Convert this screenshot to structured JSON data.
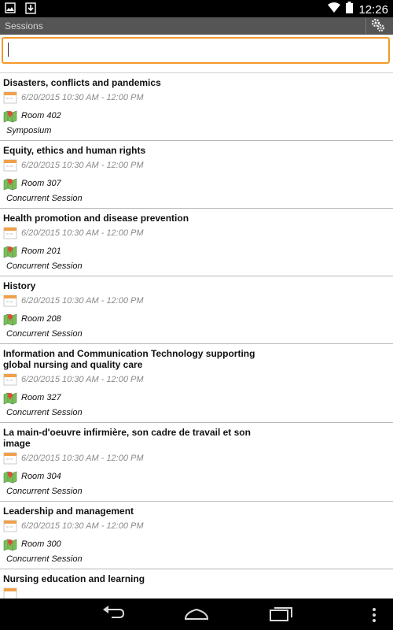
{
  "status_bar": {
    "time": "12:26"
  },
  "action_bar": {
    "title": "Sessions"
  },
  "search": {
    "value": "",
    "placeholder": ""
  },
  "sessions": [
    {
      "title": "Disasters, conflicts and pandemics",
      "datetime": "6/20/2015 10:30 AM - 12:00 PM",
      "room": "Room 402",
      "type": "Symposium"
    },
    {
      "title": "Equity, ethics and human rights",
      "datetime": "6/20/2015 10:30 AM - 12:00 PM",
      "room": "Room 307",
      "type": "Concurrent Session"
    },
    {
      "title": "Health promotion and disease prevention",
      "datetime": "6/20/2015 10:30 AM - 12:00 PM",
      "room": "Room 201",
      "type": "Concurrent Session"
    },
    {
      "title": "History",
      "datetime": "6/20/2015 10:30 AM - 12:00 PM",
      "room": "Room 208",
      "type": "Concurrent Session"
    },
    {
      "title": "Information and Communication Technology supporting global nursing and quality care",
      "datetime": "6/20/2015 10:30 AM - 12:00 PM",
      "room": "Room 327",
      "type": "Concurrent Session"
    },
    {
      "title": "La main-d'oeuvre infirmière, son cadre de travail et son image",
      "datetime": "6/20/2015 10:30 AM - 12:00 PM",
      "room": "Room 304",
      "type": "Concurrent Session"
    },
    {
      "title": "Leadership and management",
      "datetime": "6/20/2015 10:30 AM - 12:00 PM",
      "room": "Room 300",
      "type": "Concurrent Session"
    },
    {
      "title": "Nursing education and learning",
      "datetime": "",
      "room": "",
      "type": ""
    }
  ],
  "icons": {
    "calendar": "calendar-icon",
    "location": "map-location-icon",
    "settings": "gears-icon",
    "back": "back-icon",
    "home": "home-icon",
    "recents": "recent-apps-icon",
    "overflow": "overflow-menu-icon"
  },
  "colors": {
    "search_border": "#f39a2a",
    "action_bar": "#555555",
    "divider": "#b8b8b8"
  }
}
